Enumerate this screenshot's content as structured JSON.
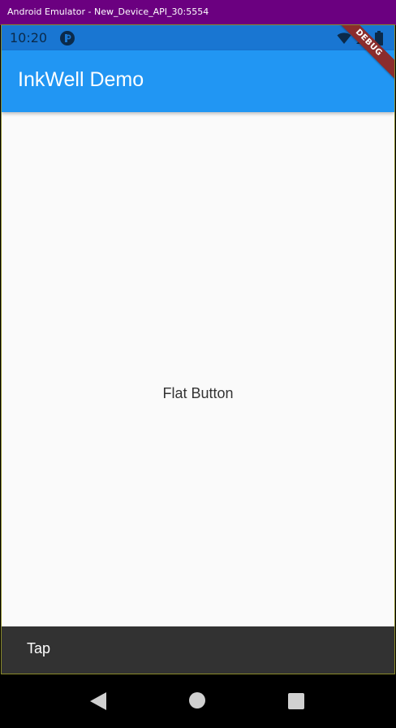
{
  "window": {
    "title": "Android Emulator - New_Device_API_30:5554"
  },
  "statusbar": {
    "time": "10:20",
    "icons": [
      "app-notification-icon",
      "wifi-icon",
      "signal-icon",
      "battery-icon"
    ]
  },
  "appbar": {
    "title": "InkWell Demo"
  },
  "debug_banner": {
    "label": "DEBUG"
  },
  "main": {
    "button_label": "Flat Button"
  },
  "snackbar": {
    "message": "Tap"
  },
  "navbar": {
    "icons": [
      "back-icon",
      "home-icon",
      "recents-icon"
    ]
  },
  "colors": {
    "window_titlebar": "#6b0080",
    "statusbar": "#1976d2",
    "appbar": "#2196f3",
    "body_background": "#fafafa",
    "snackbar": "#323232",
    "debug_ribbon": "#8b2c2c",
    "navbar": "#000000"
  }
}
